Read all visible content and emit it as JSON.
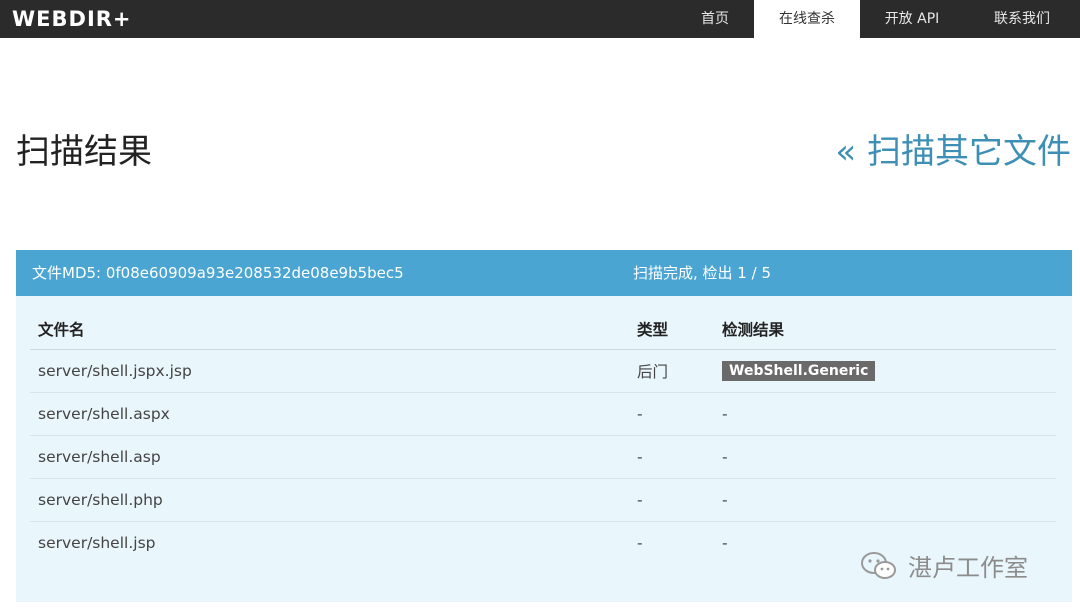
{
  "navbar": {
    "brand": "WEBDIR+",
    "items": [
      {
        "label": "首页",
        "active": false
      },
      {
        "label": "在线查杀",
        "active": true
      },
      {
        "label": "开放 API",
        "active": false
      },
      {
        "label": "联系我们",
        "active": false
      }
    ]
  },
  "page": {
    "title": "扫描结果",
    "back_link": "« 扫描其它文件"
  },
  "result_panel": {
    "md5_label": "文件MD5: 0f08e60909a93e208532de08e9b5bec5",
    "status": "扫描完成, 检出 1 / 5",
    "columns": [
      "文件名",
      "类型",
      "检测结果"
    ],
    "rows": [
      {
        "file": "server/shell.jspx.jsp",
        "type": "后门",
        "result": "WebShell.Generic"
      },
      {
        "file": "server/shell.aspx",
        "type": "-",
        "result": "-"
      },
      {
        "file": "server/shell.asp",
        "type": "-",
        "result": "-"
      },
      {
        "file": "server/shell.php",
        "type": "-",
        "result": "-"
      },
      {
        "file": "server/shell.jsp",
        "type": "-",
        "result": "-"
      }
    ]
  },
  "watermark": {
    "text": "湛卢工作室",
    "icon": "wechat-icon"
  },
  "colors": {
    "navbar_bg": "#2b2b2b",
    "panel_header_bg": "#4aa5d2",
    "panel_body_bg": "#e9f6fc",
    "link": "#3e8fb5",
    "badge_bg": "#6a6a6a"
  }
}
